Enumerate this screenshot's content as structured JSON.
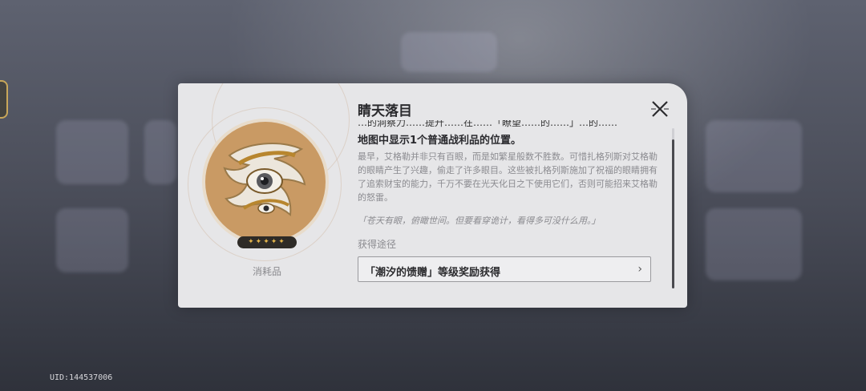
{
  "background": {
    "uid_label": "UID:144537006"
  },
  "item": {
    "name": "睛天落目",
    "rarity_stars": "✦✦✦✦✦",
    "type": "消耗品",
    "clipped_line": "…的洞察力……提升……在……「瞭望……的……」…的……",
    "effect": "地图中显示1个普通战利品的位置。",
    "description": "最早，艾格勒并非只有百眼，而是如繁星般数不胜数。可惜扎格列斯对艾格勒的眼睛产生了兴趣，偷走了许多眼目。这些被扎格列斯施加了祝福的眼睛拥有了追索财宝的能力，千万不要在光天化日之下使用它们，否则可能招来艾格勒的怒雷。",
    "quote": "「苍天有眼，俯瞰世间。但要看穿诡计，看得多可没什么用。」",
    "source_label": "获得途径",
    "source_button": "「潮汐的馈赠」等级奖励获得",
    "source_chevron": "›"
  },
  "colors": {
    "card_bg": "#e6e6e8",
    "disc": "#c99a64",
    "star": "#e4b54b",
    "accent_gold": "#c9a75a"
  },
  "icons": {
    "close": "close-icon",
    "item": "eye-relic-icon"
  }
}
